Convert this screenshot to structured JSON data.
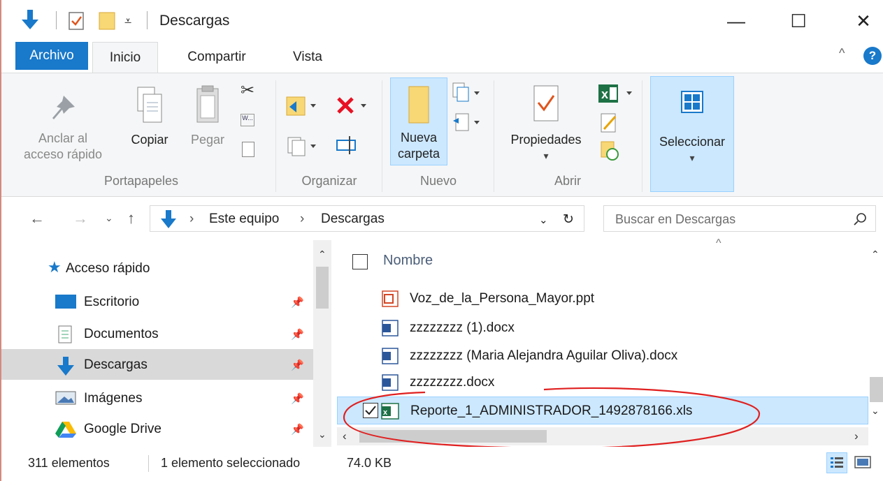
{
  "window": {
    "title": "Descargas",
    "controls": {
      "minimize": "—",
      "maximize": "☐",
      "close": "✕"
    }
  },
  "ribbon_tabs": [
    "Archivo",
    "Inicio",
    "Compartir",
    "Vista"
  ],
  "ribbon": {
    "groups": {
      "portapapeles": "Portapapeles",
      "organizar": "Organizar",
      "nuevo": "Nuevo",
      "abrir": "Abrir"
    },
    "pin_label_1": "Anclar al",
    "pin_label_2": "acceso rápido",
    "copy": "Copiar",
    "paste": "Pegar",
    "new_folder_1": "Nueva",
    "new_folder_2": "carpeta",
    "properties": "Propiedades",
    "select": "Seleccionar"
  },
  "address": {
    "crumbs": [
      "Este equipo",
      "Descargas"
    ],
    "search_placeholder": "Buscar en Descargas"
  },
  "nav_pane": {
    "quick_access": "Acceso rápido",
    "items": [
      {
        "label": "Escritorio",
        "icon": "desktop-icon"
      },
      {
        "label": "Documentos",
        "icon": "documents-icon"
      },
      {
        "label": "Descargas",
        "icon": "downloads-icon",
        "selected": true
      },
      {
        "label": "Imágenes",
        "icon": "pictures-icon"
      },
      {
        "label": "Google Drive",
        "icon": "google-drive-icon"
      }
    ]
  },
  "file_list": {
    "column_name": "Nombre",
    "files": [
      {
        "name": "Voz_de_la_Persona_Mayor.ppt",
        "type": "ppt"
      },
      {
        "name": "zzzzzzzz (1).docx",
        "type": "docx"
      },
      {
        "name": "zzzzzzzz (Maria Alejandra Aguilar Oliva).docx",
        "type": "docx"
      },
      {
        "name": "zzzzzzzz.docx",
        "type": "docx"
      },
      {
        "name": "Reporte_1_ADMINISTRADOR_1492878166.xls",
        "type": "xls",
        "selected": true
      }
    ]
  },
  "status": {
    "count": "311 elementos",
    "selection": "1 elemento seleccionado",
    "size": "74.0 KB"
  },
  "colors": {
    "accent": "#1979ca",
    "selection": "#cce8ff",
    "annotation": "#e02020"
  }
}
